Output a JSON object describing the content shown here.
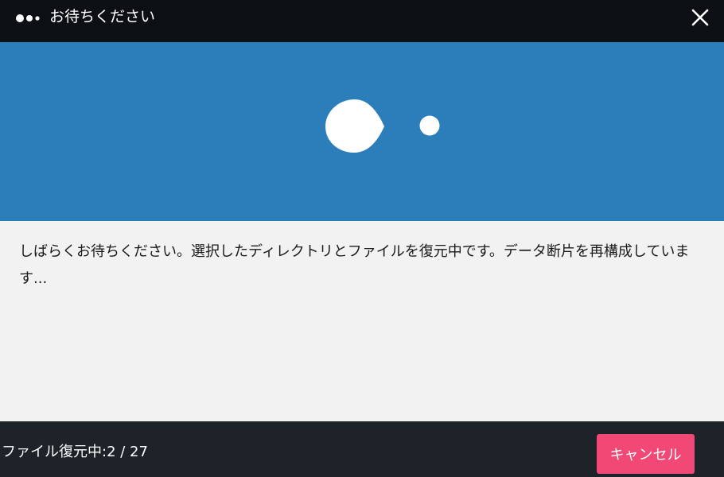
{
  "titlebar": {
    "title": "お待ちください",
    "icon": "loading-dots-icon",
    "close_icon": "close-icon"
  },
  "banner": {
    "icon": "loading-animation-icon",
    "color": "#2b7eb9"
  },
  "content": {
    "message": "しばらくお待ちください。選択したディレクトリとファイルを復元中です。データ断片を再構成していま す..."
  },
  "footer": {
    "status_text": "ファイル復元中:2 / 27",
    "progress": {
      "current": 2,
      "total": 27
    },
    "cancel_label": "キャンセル",
    "cancel_color": "#f14876"
  }
}
